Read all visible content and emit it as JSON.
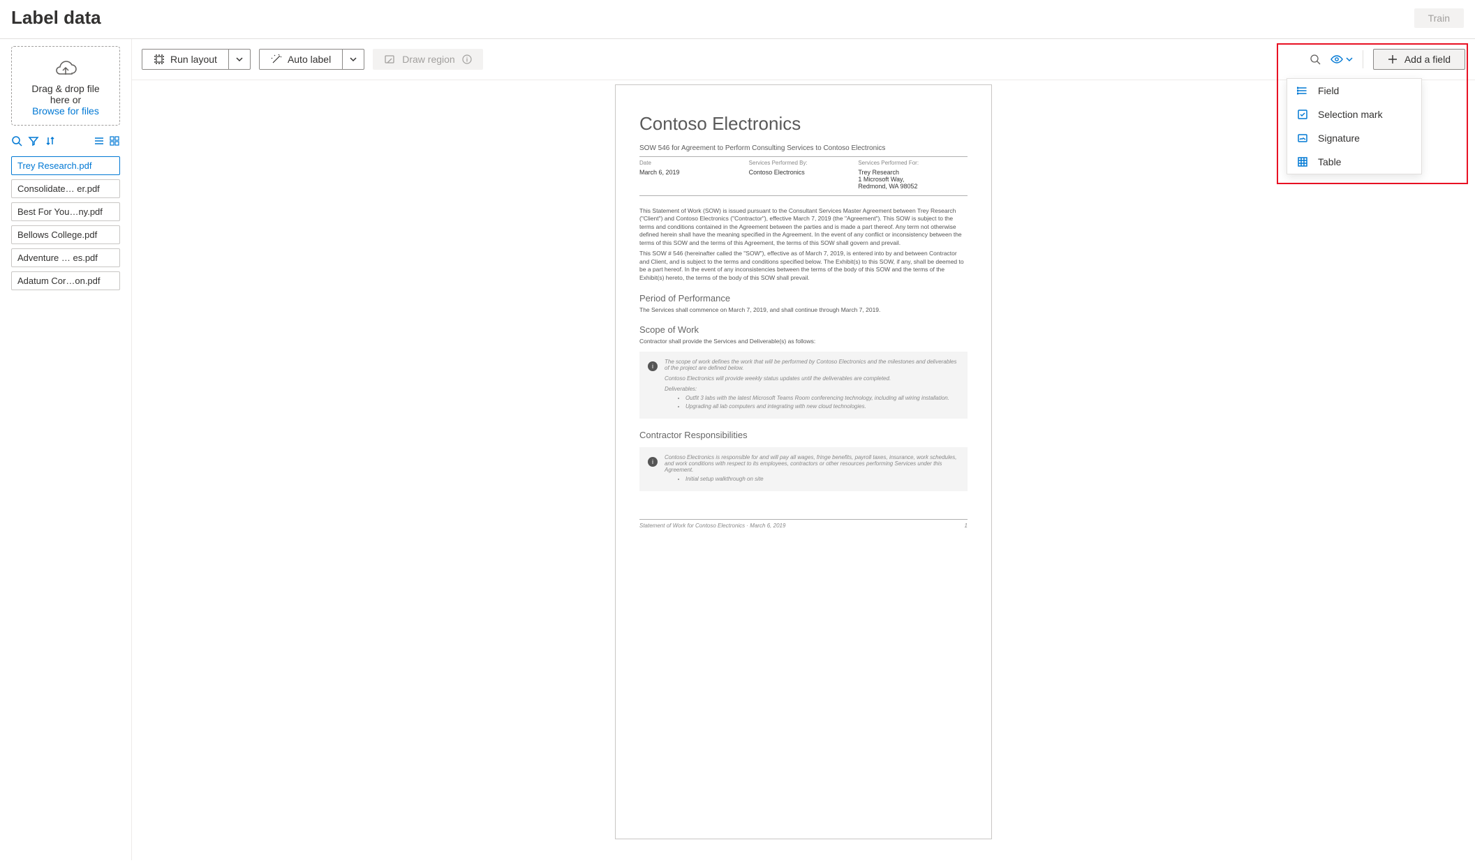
{
  "header": {
    "title": "Label data",
    "train_label": "Train"
  },
  "sidebar": {
    "dropzone_line1": "Drag & drop file",
    "dropzone_line2": "here or",
    "browse_label": "Browse for files",
    "files": [
      "Trey Research.pdf",
      "Consolidate… er.pdf",
      "Best For You…ny.pdf",
      "Bellows College.pdf",
      "Adventure … es.pdf",
      "Adatum Cor…on.pdf"
    ]
  },
  "toolbar": {
    "run_layout_label": "Run layout",
    "auto_label_label": "Auto label",
    "draw_region_label": "Draw region",
    "add_field_label": "Add a field",
    "menu": {
      "field": "Field",
      "selection_mark": "Selection mark",
      "signature": "Signature",
      "table": "Table"
    }
  },
  "document": {
    "title": "Contoso Electronics",
    "sow_line": "SOW 546 for Agreement to Perform Consulting Services to Contoso Electronics",
    "col_date_label": "Date",
    "col_date_value": "March 6, 2019",
    "col_perf_by_label": "Services Performed By:",
    "col_perf_by_value": "Contoso Electronics",
    "col_perf_for_label": "Services Performed For:",
    "col_perf_for_line1": "Trey Research",
    "col_perf_for_line2": "1 Microsoft Way,",
    "col_perf_for_line3": "Redmond, WA 98052",
    "para1": "This Statement of Work (SOW) is issued pursuant to the Consultant Services Master Agreement between Trey Research (\"Client\") and Contoso Electronics (\"Contractor\"), effective March 7, 2019 (the \"Agreement\"). This SOW is subject to the terms and conditions contained in the Agreement between the parties and is made a part thereof. Any term not otherwise defined herein shall have the meaning specified in the Agreement. In the event of any conflict or inconsistency between the terms of this SOW and the terms of this Agreement, the terms of this SOW shall govern and prevail.",
    "para2": "This SOW # 546 (hereinafter called the \"SOW\"), effective as of March 7, 2019, is entered into by and between Contractor and Client, and is subject to the terms and conditions specified below. The Exhibit(s) to this SOW, if any, shall be deemed to be a part hereof. In the event of any inconsistencies between the terms of the body of this SOW and the terms of the Exhibit(s) hereto, the terms of the body of this SOW shall prevail.",
    "h_period": "Period of Performance",
    "period_line": "The Services shall commence on March 7, 2019, and shall continue through March 7, 2019.",
    "h_scope": "Scope of Work",
    "scope_line": "Contractor shall provide the Services and Deliverable(s) as follows:",
    "scope_note1": "The scope of work defines the work that will be performed by Contoso Electronics and the milestones and deliverables of the project are defined below.",
    "scope_note2": "Contoso Electronics will provide weekly status updates until the deliverables are completed.",
    "scope_deliv_label": "Deliverables:",
    "scope_deliv1": "Outfit 3 labs with the latest Microsoft Teams Room conferencing technology, including all wiring installation.",
    "scope_deliv2": "Upgrading all lab computers and integrating with new cloud technologies.",
    "h_resp": "Contractor Responsibilities",
    "resp_note": "Contoso Electronics is responsible for and will pay all wages, fringe benefits, payroll taxes, insurance, work schedules, and work conditions with respect to its employees, contractors or other resources performing Services under this Agreement.",
    "resp_bullet": "Initial setup walkthrough on site",
    "footer_left": "Statement of Work for Contoso Electronics · March 6, 2019",
    "footer_right": "1"
  }
}
